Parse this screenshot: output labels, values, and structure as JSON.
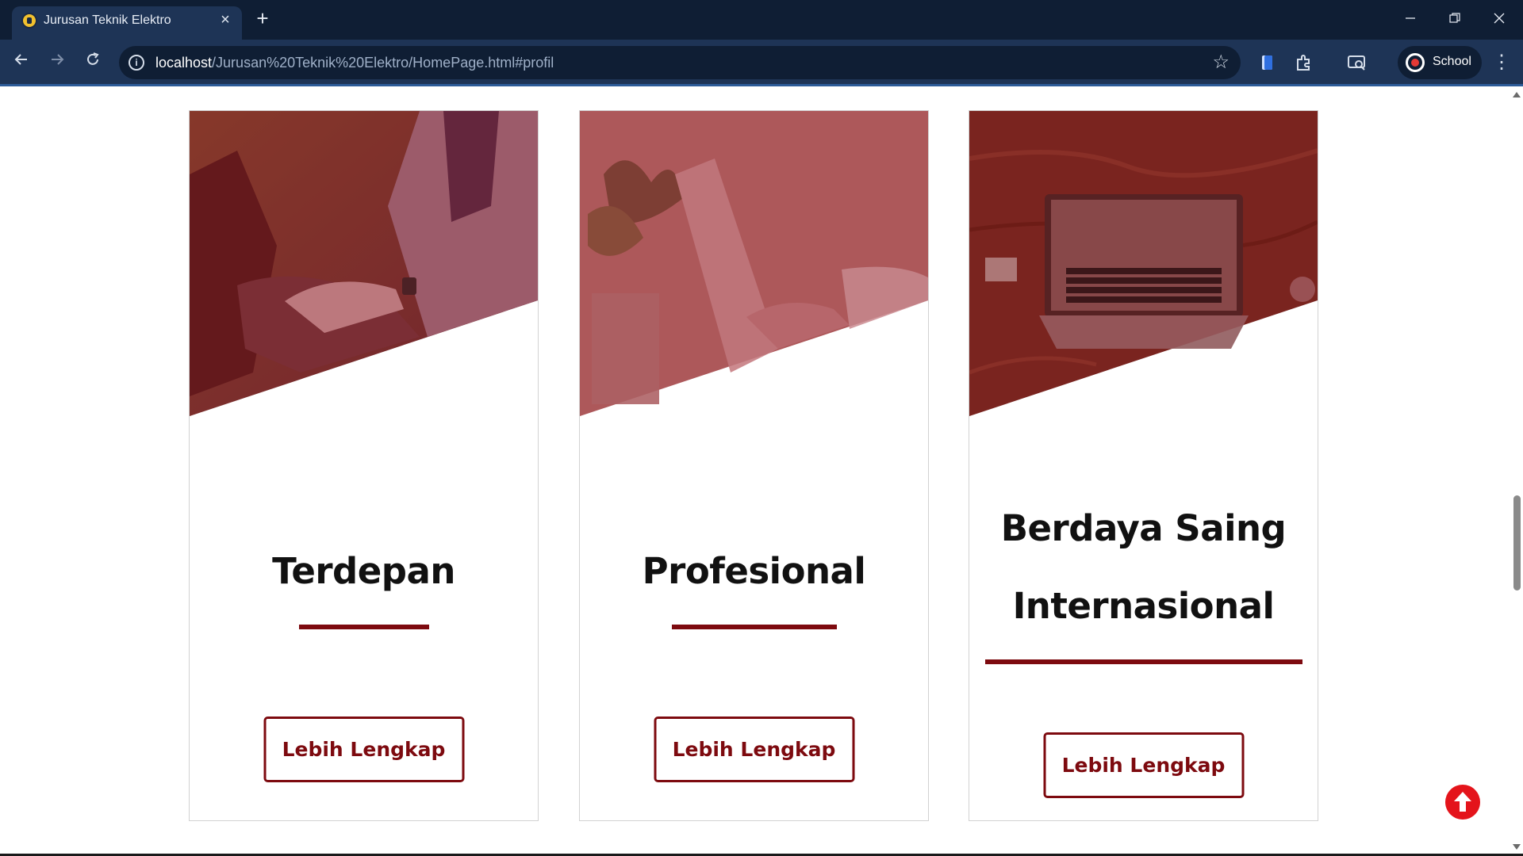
{
  "browser": {
    "tab_title": "Jurusan Teknik Elektro",
    "url_host": "localhost",
    "url_path": "/Jurusan%20Teknik%20Elektro/HomePage.html#profil",
    "profile_label": "School"
  },
  "cards": [
    {
      "title_lines": [
        "Terdepan"
      ],
      "button_label": "Lebih Lengkap"
    },
    {
      "title_lines": [
        "Profesional"
      ],
      "button_label": "Lebih Lengkap"
    },
    {
      "title_lines": [
        "Berdaya Saing",
        "Internasional"
      ],
      "button_label": "Lebih Lengkap"
    }
  ],
  "colors": {
    "accent": "#7d0a0f",
    "browser_frame": "#0f1e34",
    "browser_toolbar": "#1e3456",
    "back_to_top": "#e4141b"
  },
  "icons": [
    "back-icon",
    "forward-icon",
    "reload-icon",
    "site-info-icon",
    "star-icon",
    "extensions-icon",
    "cast-icon",
    "menu-icon",
    "arrow-up-icon"
  ]
}
